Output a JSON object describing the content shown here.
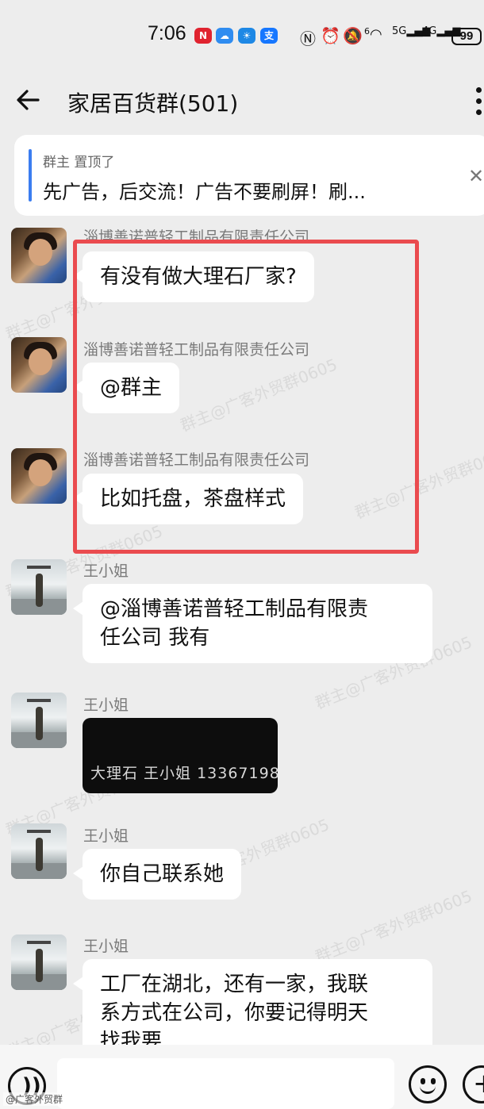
{
  "status_bar": {
    "time": "7:06",
    "battery": "99",
    "network_5g": "5G",
    "network_4g": "4G",
    "wifi_label": "6"
  },
  "header": {
    "title": "家居百货群(501)"
  },
  "pinned": {
    "meta": "群主 置顶了",
    "text": "先广告，后交流！广告不要刷屏！刷..."
  },
  "messages": [
    {
      "sender": "淄博善诺普轻工制品有限责任公司",
      "text": "有没有做大理石厂家?"
    },
    {
      "sender": "淄博善诺普轻工制品有限责任公司",
      "text": "@群主"
    },
    {
      "sender": "淄博善诺普轻工制品有限责任公司",
      "text": "比如托盘，茶盘样式"
    },
    {
      "sender": "王小姐",
      "text_line1": "@淄博善诺普轻工制品有限责",
      "text_line2": "任公司  我有"
    },
    {
      "sender": "王小姐",
      "image_text": "大理石 王小姐 13367198"
    },
    {
      "sender": "王小姐",
      "text": "你自己联系她"
    },
    {
      "sender": "王小姐",
      "text_line1": "工厂在湖北，还有一家，我联",
      "text_line2": "系方式在公司，你要记得明天",
      "text_line3": "找我要"
    }
  ],
  "watermark": "群主@广客外贸群0605",
  "corner_mark": "@广客外贸群",
  "colors": {
    "highlight": "#ea4b4f",
    "pin_accent": "#3b7df0",
    "background": "#ededed"
  }
}
